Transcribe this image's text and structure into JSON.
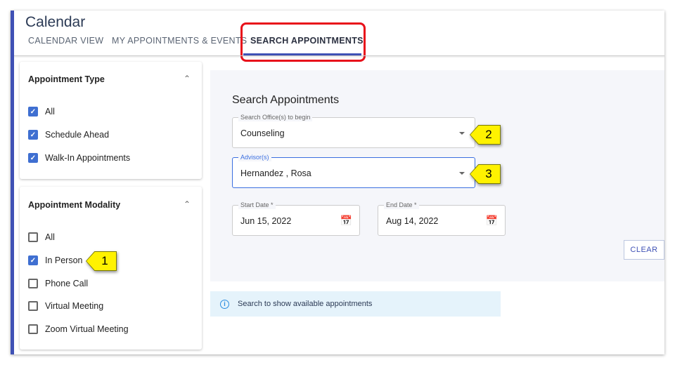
{
  "header": {
    "title": "Calendar"
  },
  "tabs": [
    {
      "label": "CALENDAR VIEW"
    },
    {
      "label": "MY APPOINTMENTS & EVENTS"
    },
    {
      "label": "SEARCH APPOINTMENTS",
      "active": true
    }
  ],
  "filters": {
    "appointment_type": {
      "title": "Appointment Type",
      "items": [
        {
          "label": "All",
          "checked": true
        },
        {
          "label": "Schedule Ahead",
          "checked": true
        },
        {
          "label": "Walk-In Appointments",
          "checked": true
        }
      ]
    },
    "appointment_modality": {
      "title": "Appointment Modality",
      "items": [
        {
          "label": "All",
          "checked": false
        },
        {
          "label": "In Person",
          "checked": true
        },
        {
          "label": "Phone Call",
          "checked": false
        },
        {
          "label": "Virtual Meeting",
          "checked": false
        },
        {
          "label": "Zoom Virtual Meeting",
          "checked": false
        }
      ]
    }
  },
  "search": {
    "title": "Search Appointments",
    "office": {
      "label": "Search Office(s) to begin",
      "value": "Counseling"
    },
    "advisor": {
      "label": "Advisor(s)",
      "value": "Hernandez , Rosa"
    },
    "start_date": {
      "label": "Start Date *",
      "value": "Jun 15, 2022"
    },
    "end_date": {
      "label": "End Date *",
      "value": "Aug 14, 2022"
    },
    "clear_label": "CLEAR"
  },
  "info": {
    "text": "Search to show available appointments"
  },
  "callouts": [
    "1",
    "2",
    "3"
  ],
  "colors": {
    "accent": "#3f51b5",
    "highlight": "#e8101a",
    "callout": "#fff200",
    "checkbox": "#3f6fd1"
  }
}
